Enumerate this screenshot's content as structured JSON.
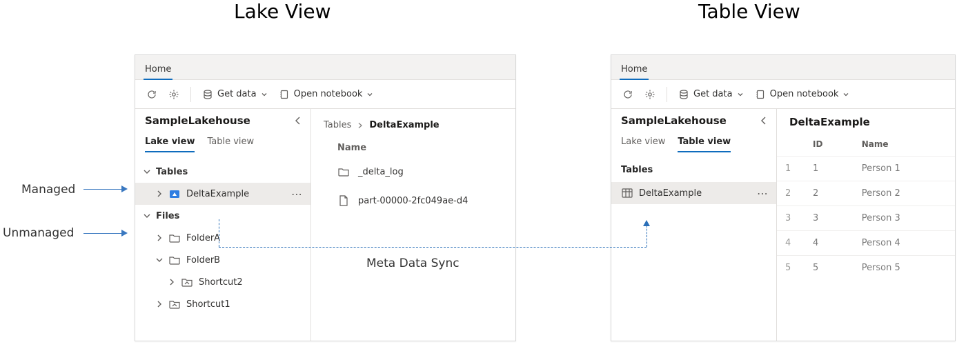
{
  "titles": {
    "lake": "Lake View",
    "table": "Table View"
  },
  "annotations": {
    "managed": "Managed",
    "unmanaged": "Unmanaged",
    "metadata": "Meta Data Sync"
  },
  "toolbar": {
    "home": "Home",
    "get_data": "Get data",
    "open_notebook": "Open notebook"
  },
  "lake": {
    "lakehouse_name": "SampleLakehouse",
    "tabs": {
      "lake": "Lake view",
      "table": "Table view"
    },
    "tree": {
      "tables": "Tables",
      "delta_example": "DeltaExample",
      "files": "Files",
      "folder_a": "FolderA",
      "folder_b": "FolderB",
      "shortcut2": "Shortcut2",
      "shortcut1": "Shortcut1"
    },
    "breadcrumb": {
      "root": "Tables",
      "current": "DeltaExample"
    },
    "listing": {
      "header_name": "Name",
      "rows": {
        "delta_log": "_delta_log",
        "part_file": "part-00000-2fc049ae-d4"
      }
    }
  },
  "tableview": {
    "lakehouse_name": "SampleLakehouse",
    "tabs": {
      "lake": "Lake view",
      "table": "Table view"
    },
    "section": "Tables",
    "delta_example": "DeltaExample",
    "data_title": "DeltaExample",
    "columns": {
      "index": "",
      "id": "ID",
      "name": "Name"
    },
    "rows": [
      {
        "n": "1",
        "id": "1",
        "name": "Person 1"
      },
      {
        "n": "2",
        "id": "2",
        "name": "Person 2"
      },
      {
        "n": "3",
        "id": "3",
        "name": "Person 3"
      },
      {
        "n": "4",
        "id": "4",
        "name": "Person 4"
      },
      {
        "n": "5",
        "id": "5",
        "name": "Person 5"
      }
    ]
  }
}
